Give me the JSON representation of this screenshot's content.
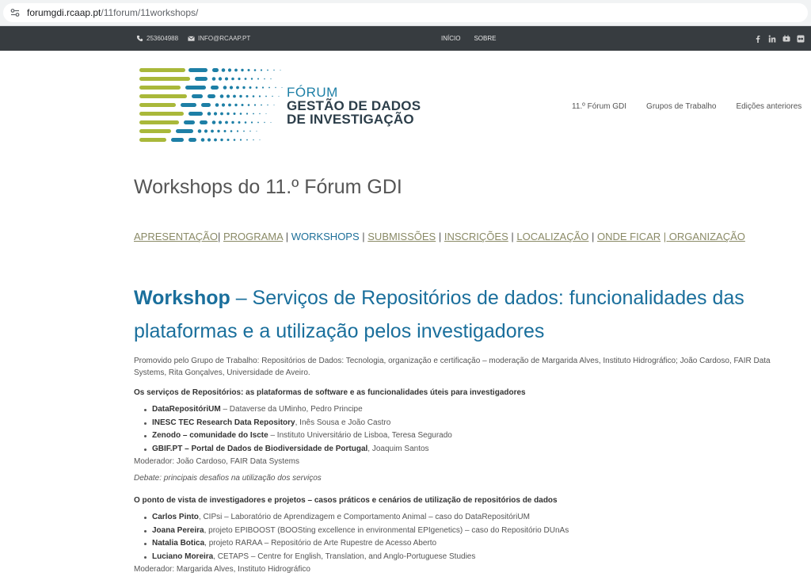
{
  "browser": {
    "url_domain": "forumgdi.rcaap.pt",
    "url_path": "/11forum/11workshops/"
  },
  "topbar": {
    "phone": "253604988",
    "email": "INFO@RCAAP.PT",
    "nav": [
      "INÍCIO",
      "SOBRE"
    ],
    "social_icons": [
      "facebook-icon",
      "linkedin-icon",
      "youtube-icon",
      "flickr-icon"
    ]
  },
  "header": {
    "logo_line1": "FÓRUM",
    "logo_line2": "GESTÃO DE DADOS",
    "logo_line3": "DE INVESTIGAÇÃO",
    "nav": [
      "11.º Fórum GDI",
      "Grupos de Trabalho",
      "Edições anteriores"
    ]
  },
  "page": {
    "title": "Workshops do 11.º Fórum GDI"
  },
  "section_nav": {
    "items": [
      "APRESENTAÇÃO",
      "PROGRAMA",
      "WORKSHOPS",
      "SUBMISSÕES",
      "INSCRIÇÕES",
      "LOCALIZAÇÃO",
      "ONDE FICAR",
      "ORGANIZAÇÃO"
    ]
  },
  "workshop": {
    "title_strong": "Workshop",
    "title_rest": " – Serviços de Repositórios de dados: funcionalidades das plataformas e a utilização pelos investigadores",
    "promo": "Promovido pelo Grupo de Trabalho: Repositórios de Dados: Tecnologia, organização e certificação – moderação de Margarida Alves, Instituto Hidrográfico; João Cardoso, FAIR Data Systems, Rita Gonçalves, Universidade de Aveiro.",
    "section1": {
      "heading": "Os serviços de Repositórios: as plataformas de software e as funcionalidades úteis para investigadores",
      "items": [
        {
          "name": "DataRepositóriUM",
          "rest": " – Dataverse da UMinho, Pedro Principe"
        },
        {
          "name": "INESC TEC Research Data Repository",
          "rest": ", Inês Sousa e João Castro"
        },
        {
          "name": "Zenodo – comunidade do Iscte",
          "rest": " – Instituto Universitário de Lisboa, Teresa Segurado"
        },
        {
          "name": "GBIF.PT – Portal de Dados de Biodiversidade de Portugal",
          "rest": ", Joaquim Santos"
        }
      ],
      "moderator": "Moderador: João Cardoso, FAIR Data Systems",
      "debate": "Debate: principais desafios na utilização dos serviços"
    },
    "section2": {
      "heading": "O ponto de vista de investigadores e projetos – casos práticos e cenários de utilização de repositórios de dados",
      "items": [
        {
          "name": "Carlos Pinto",
          "rest": ", CIPsi – Laboratório de Aprendizagem e Comportamento Animal – caso do DataRepositóriUM"
        },
        {
          "name": "Joana Pereira",
          "rest": ", projeto EPIBOOST (BOOSting excellence in environmental EPIgenetics) – caso do Repositório DUnAs"
        },
        {
          "name": "Natalia Botica",
          "rest": ", projeto RARAA – Repositório de Arte Rupestre de Acesso Aberto"
        },
        {
          "name": "Luciano Moreira",
          "rest": ", CETAPS – Centre for English, Translation, and Anglo-Portuguese Studies"
        }
      ],
      "moderator": "Moderador: Margarida Alves, Instituto Hidrográfico"
    }
  },
  "colors": {
    "topbar": "#373c40",
    "accent_blue": "#1a6f9c",
    "link_olive": "#8a8a66",
    "logo_green": "#a9b83a",
    "logo_blue": "#1d7fa6"
  }
}
